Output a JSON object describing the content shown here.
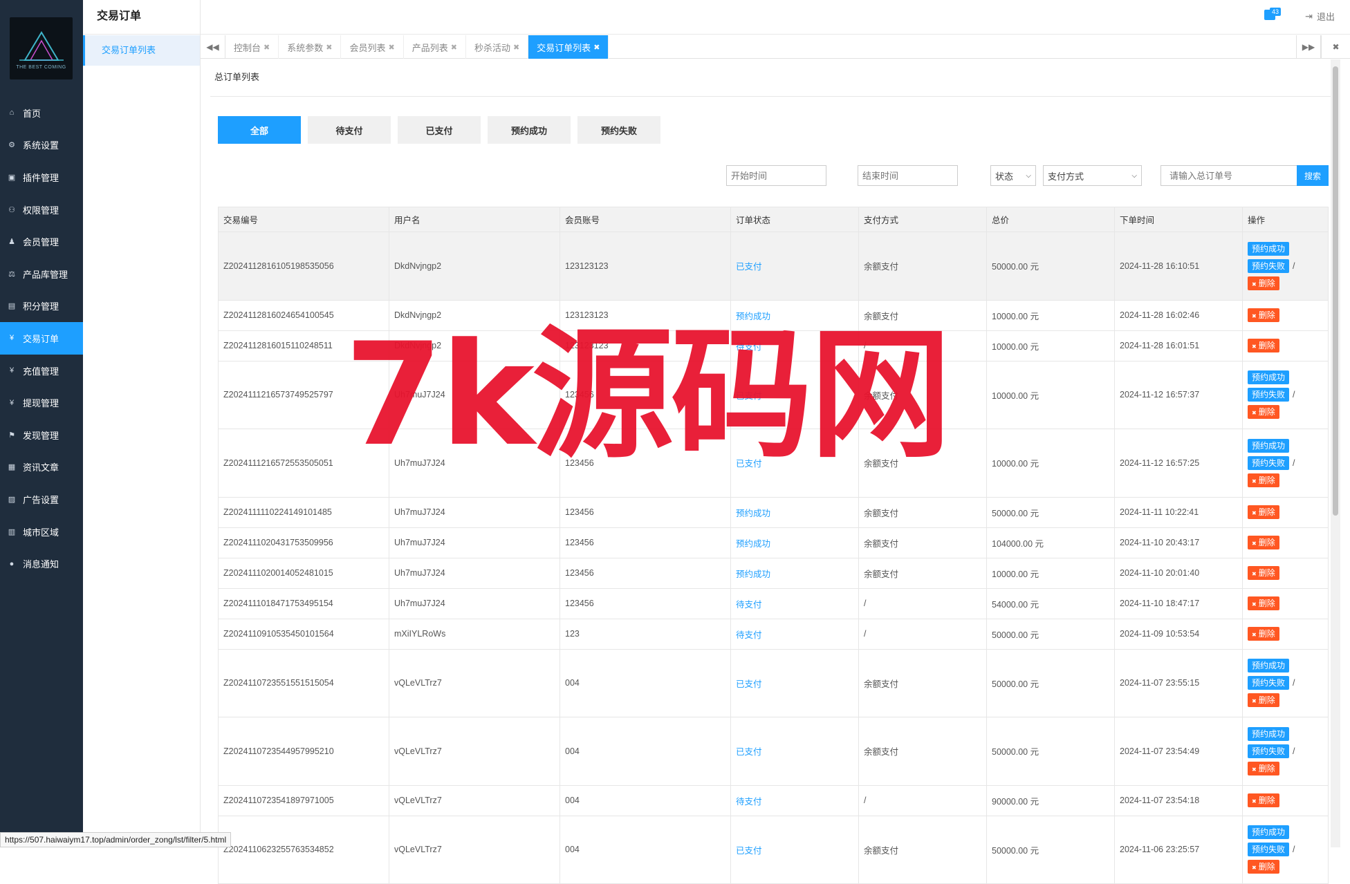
{
  "sidebar": {
    "logo_text": "THE BEST COMING",
    "items": [
      {
        "label": "首页",
        "icon": "home-icon",
        "glyph": "⌂"
      },
      {
        "label": "系统设置",
        "icon": "gear-icon",
        "glyph": "⚙"
      },
      {
        "label": "插件管理",
        "icon": "plugin-icon",
        "glyph": "▣"
      },
      {
        "label": "权限管理",
        "icon": "sitemap-icon",
        "glyph": "⚇"
      },
      {
        "label": "会员管理",
        "icon": "users-icon",
        "glyph": "♟"
      },
      {
        "label": "产品库管理",
        "icon": "scale-icon",
        "glyph": "⚖"
      },
      {
        "label": "积分管理",
        "icon": "file-icon",
        "glyph": "▤"
      },
      {
        "label": "交易订单",
        "icon": "yen-icon",
        "glyph": "¥"
      },
      {
        "label": "充值管理",
        "icon": "yen-icon",
        "glyph": "¥"
      },
      {
        "label": "提现管理",
        "icon": "yen-icon",
        "glyph": "¥"
      },
      {
        "label": "发现管理",
        "icon": "flag-icon",
        "glyph": "⚑"
      },
      {
        "label": "资讯文章",
        "icon": "newspaper-icon",
        "glyph": "▦"
      },
      {
        "label": "广告设置",
        "icon": "image-icon",
        "glyph": "▨"
      },
      {
        "label": "城市区域",
        "icon": "map-icon",
        "glyph": "▥"
      },
      {
        "label": "消息通知",
        "icon": "comment-icon",
        "glyph": "●"
      }
    ]
  },
  "submenu": {
    "title": "交易订单",
    "item": "交易订单列表"
  },
  "header": {
    "message_count": "43",
    "logout": "退出"
  },
  "tabs": [
    {
      "label": "控制台",
      "active": false
    },
    {
      "label": "系统参数",
      "active": false
    },
    {
      "label": "会员列表",
      "active": false
    },
    {
      "label": "产品列表",
      "active": false
    },
    {
      "label": "秒杀活动",
      "active": false
    },
    {
      "label": "交易订单列表",
      "active": true
    }
  ],
  "panel": {
    "title": "总订单列表"
  },
  "filter_tabs": [
    "全部",
    "待支付",
    "已支付",
    "预约成功",
    "预约失败"
  ],
  "search": {
    "start_placeholder": "开始时间",
    "end_placeholder": "结束时间",
    "status_select": "状态",
    "pay_select": "支付方式",
    "order_placeholder": "请输入总订单号",
    "button": "搜索"
  },
  "table": {
    "headers": [
      "交易编号",
      "用户名",
      "会员账号",
      "订单状态",
      "支付方式",
      "总价",
      "下单时间",
      "操作"
    ],
    "action_labels": {
      "success": "预约成功",
      "fail": "预约失败",
      "delete": "删除"
    },
    "rows": [
      {
        "id": "Z20241128161051985350 56",
        "user": "DkdNvjngp2",
        "account": "123123123",
        "status": "已支付",
        "pay": "余额支付",
        "total": "50000.00 元",
        "time": "2024-11-28 16:10:51",
        "tall": true
      },
      {
        "id": "Z20241128160246541005 45",
        "user": "DkdNvjngp2",
        "account": "123123123",
        "status": "预约成功",
        "pay": "余额支付",
        "total": "10000.00 元",
        "time": "2024-11-28 16:02:46",
        "tall": false
      },
      {
        "id": "Z20241128160151102485 11",
        "user": "DkdNvjngp2",
        "account": "123123123",
        "status": "待支付",
        "pay": "/",
        "total": "10000.00 元",
        "time": "2024-11-28 16:01:51",
        "tall": false
      },
      {
        "id": "Z20241112165737495257 97",
        "user": "Uh7muJ7J24",
        "account": "123456",
        "status": "已支付",
        "pay": "余额支付",
        "total": "10000.00 元",
        "time": "2024-11-12 16:57:37",
        "tall": true
      },
      {
        "id": "Z20241112165725535050 51",
        "user": "Uh7muJ7J24",
        "account": "123456",
        "status": "已支付",
        "pay": "余额支付",
        "total": "10000.00 元",
        "time": "2024-11-12 16:57:25",
        "tall": true
      },
      {
        "id": "Z20241111102241491014 85",
        "user": "Uh7muJ7J24",
        "account": "123456",
        "status": "预约成功",
        "pay": "余额支付",
        "total": "50000.00 元",
        "time": "2024-11-11 10:22:41",
        "tall": false
      },
      {
        "id": "Z20241110204317535099 56",
        "user": "Uh7muJ7J24",
        "account": "123456",
        "status": "预约成功",
        "pay": "余额支付",
        "total": "104000.00 元",
        "time": "2024-11-10 20:43:17",
        "tall": false
      },
      {
        "id": "Z20241110200140524810 15",
        "user": "Uh7muJ7J24",
        "account": "123456",
        "status": "预约成功",
        "pay": "余额支付",
        "total": "10000.00 元",
        "time": "2024-11-10 20:01:40",
        "tall": false
      },
      {
        "id": "Z20241110184717534951 54",
        "user": "Uh7muJ7J24",
        "account": "123456",
        "status": "待支付",
        "pay": "/",
        "total": "54000.00 元",
        "time": "2024-11-10 18:47:17",
        "tall": false
      },
      {
        "id": "Z20241109105354501015 64",
        "user": "mXiIYLRoWs",
        "account": "123",
        "status": "待支付",
        "pay": "/",
        "total": "50000.00 元",
        "time": "2024-11-09 10:53:54",
        "tall": false
      },
      {
        "id": "Z20241107235515515150 54",
        "user": "vQLeVLTrz7",
        "account": "004",
        "status": "已支付",
        "pay": "余额支付",
        "total": "50000.00 元",
        "time": "2024-11-07 23:55:15",
        "tall": true
      },
      {
        "id": "Z20241107235449579952 10",
        "user": "vQLeVLTrz7",
        "account": "004",
        "status": "已支付",
        "pay": "余额支付",
        "total": "50000.00 元",
        "time": "2024-11-07 23:54:49",
        "tall": true
      },
      {
        "id": "Z20241107235418979710 05",
        "user": "vQLeVLTrz7",
        "account": "004",
        "status": "待支付",
        "pay": "/",
        "total": "90000.00 元",
        "time": "2024-11-07 23:54:18",
        "tall": false
      },
      {
        "id": "Z20241106232557635348 52",
        "user": "vQLeVLTrz7",
        "account": "004",
        "status": "已支付",
        "pay": "余额支付",
        "total": "50000.00 元",
        "time": "2024-11-06 23:25:57",
        "tall": true
      }
    ]
  },
  "watermark": "7k源码网",
  "status_url": "https://507.haiwaiym17.top/admin/order_zong/lst/filter/5.html",
  "colors": {
    "accent": "#1e9fff",
    "danger": "#ff5722",
    "sidebar_bg": "#1f2d3d",
    "watermark": "#e8132d"
  }
}
